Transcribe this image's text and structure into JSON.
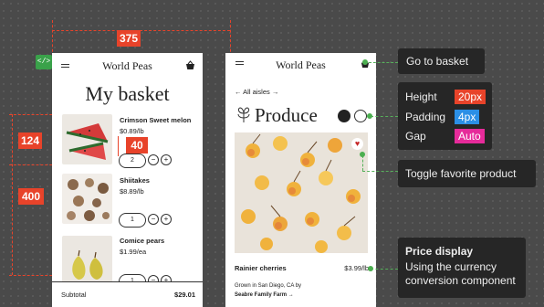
{
  "measure": {
    "width": "375",
    "item_h": "124",
    "list_h": "400",
    "gap": "40"
  },
  "left": {
    "brand": "World Peas",
    "title": "My basket",
    "items": [
      {
        "name": "Crimson Sweet melon",
        "price": "$0.89/lb",
        "qty": "2"
      },
      {
        "name": "Shiitakes",
        "price": "$8.89/lb",
        "qty": "1"
      },
      {
        "name": "Comice pears",
        "price": "$1.99/ea",
        "qty": "1"
      }
    ],
    "subtotal_label": "Subtotal",
    "subtotal_value": "$29.01"
  },
  "right": {
    "brand": "World Peas",
    "breadcrumb": "All aisles",
    "title": "Produce",
    "product_name": "Rainier cherries",
    "product_price": "$3.99/lb",
    "origin": "Grown in San Diego, CA by",
    "farm": "Seabre Family Farm"
  },
  "callouts": {
    "basket": "Go to basket",
    "specs": [
      {
        "label": "Height",
        "value": "20px",
        "color": "#e8432a"
      },
      {
        "label": "Padding",
        "value": "4px",
        "color": "#2b8fe6"
      },
      {
        "label": "Gap",
        "value": "Auto",
        "color": "#e62b9a"
      }
    ],
    "favorite": "Toggle favorite product",
    "price_title": "Price display",
    "price_desc": "Using the currency conversion component"
  },
  "colors": {
    "annotation_red": "#e8432a",
    "callout_green": "#4caf50"
  }
}
